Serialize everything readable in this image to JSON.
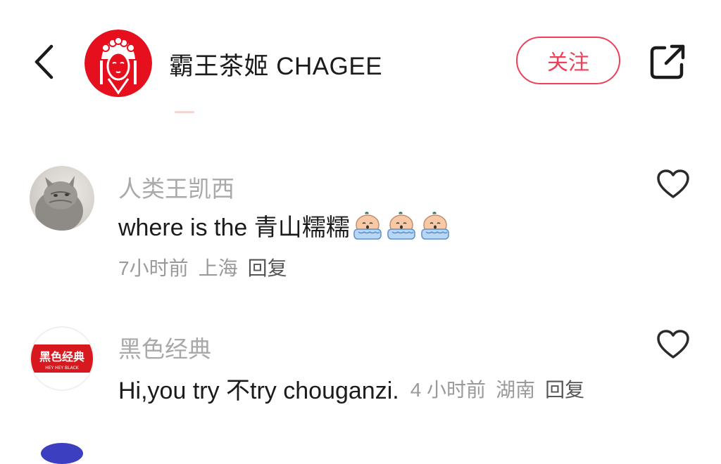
{
  "header": {
    "brand_name": "霸王茶姬 CHAGEE",
    "follow_label": "关注"
  },
  "comments": [
    {
      "username": "人类王凯西",
      "text": "where is the 青山糯糯",
      "emoji_count": 3,
      "time": "7小时前",
      "location": "上海",
      "reply_label": "回复"
    },
    {
      "username": "黑色经典",
      "avatar_text": "黑色经典",
      "avatar_subtext": "HEY HEY BLACK",
      "text": "Hi,you try 不try chouganzi.",
      "time": "4 小时前",
      "location": "湖南",
      "reply_label": "回复"
    }
  ],
  "colors": {
    "accent": "#ef3f5a",
    "brand_red": "#e60f1e",
    "secondary_text": "#9a9a9a"
  }
}
